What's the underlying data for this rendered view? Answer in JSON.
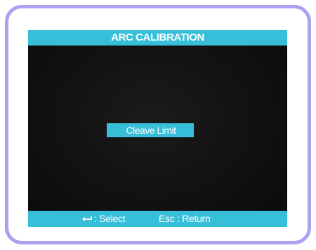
{
  "header": {
    "title": "ARC CALIBRATION"
  },
  "menu": {
    "items": [
      {
        "label": "Cleave Limit",
        "selected": true
      }
    ]
  },
  "footer": {
    "select_icon": "enter-icon",
    "select_label": ": Select",
    "return_label": "Esc : Return"
  },
  "colors": {
    "accent": "#37bfd9",
    "screen_background": "#111111",
    "frame_border": "#a9a2f0",
    "text": "#ffffff"
  }
}
